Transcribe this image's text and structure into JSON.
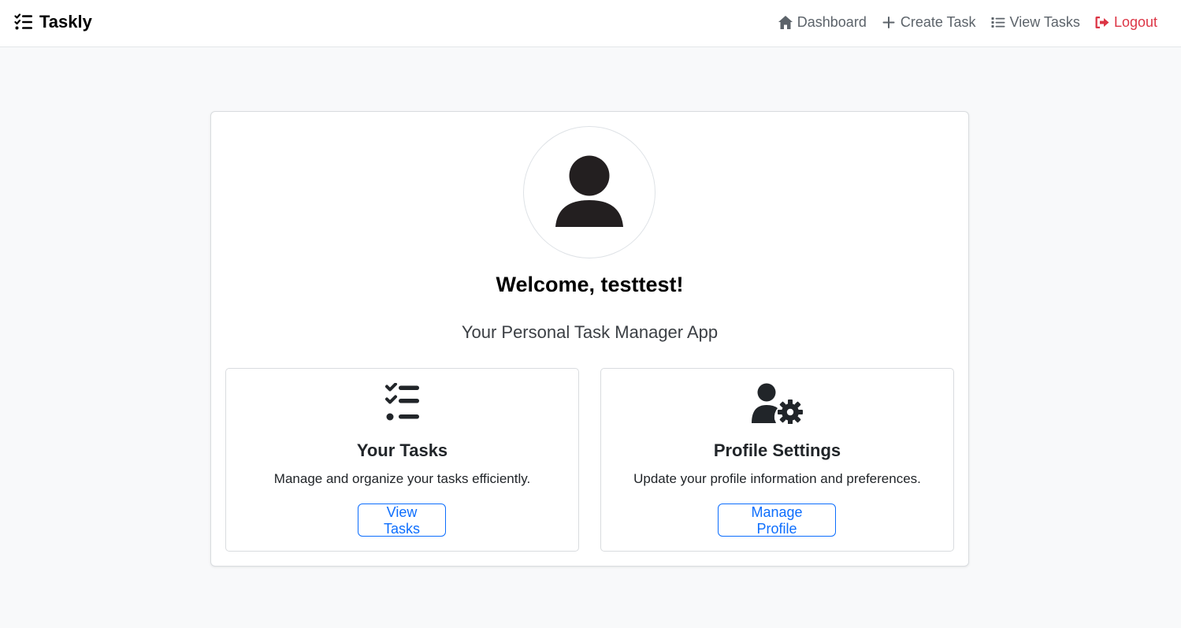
{
  "navbar": {
    "brand": "Taskly",
    "brand_icon": "list-check-icon",
    "links": [
      {
        "label": "Dashboard",
        "icon": "home-icon"
      },
      {
        "label": "Create Task",
        "icon": "plus-icon"
      },
      {
        "label": "View Tasks",
        "icon": "list-icon"
      },
      {
        "label": "Logout",
        "icon": "logout-icon",
        "color": "#dc3545"
      }
    ]
  },
  "main": {
    "avatar_icon": "user-icon",
    "welcome": "Welcome, testtest!",
    "subtitle": "Your Personal Task Manager App",
    "cards": [
      {
        "icon": "list-check-icon",
        "title": "Your Tasks",
        "description": "Manage and organize your tasks efficiently.",
        "button": "View Tasks"
      },
      {
        "icon": "user-gear-icon",
        "title": "Profile Settings",
        "description": "Update your profile information and preferences.",
        "button": "Manage Profile"
      }
    ]
  },
  "colors": {
    "primary": "#0d6efd",
    "danger": "#dc3545",
    "background": "#f8f9fa",
    "nav_text": "#5c636a"
  }
}
